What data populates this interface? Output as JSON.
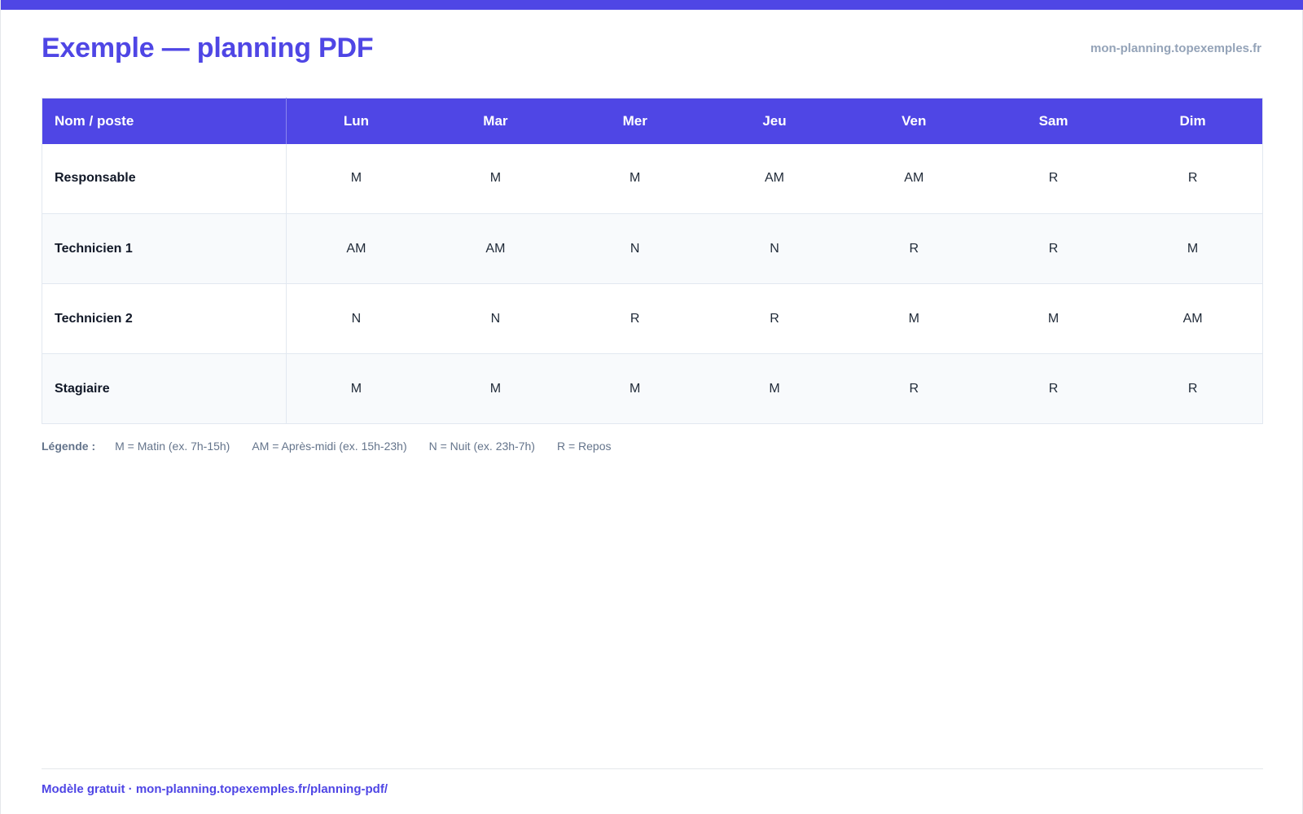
{
  "header": {
    "title": "Exemple — planning PDF",
    "site": "mon-planning.topexemples.fr"
  },
  "table": {
    "name_header": "Nom / poste",
    "days": [
      "Lun",
      "Mar",
      "Mer",
      "Jeu",
      "Ven",
      "Sam",
      "Dim"
    ],
    "rows": [
      {
        "name": "Responsable",
        "shifts": [
          "M",
          "M",
          "M",
          "AM",
          "AM",
          "R",
          "R"
        ]
      },
      {
        "name": "Technicien 1",
        "shifts": [
          "AM",
          "AM",
          "N",
          "N",
          "R",
          "R",
          "M"
        ]
      },
      {
        "name": "Technicien 2",
        "shifts": [
          "N",
          "N",
          "R",
          "R",
          "M",
          "M",
          "AM"
        ]
      },
      {
        "name": "Stagiaire",
        "shifts": [
          "M",
          "M",
          "M",
          "M",
          "R",
          "R",
          "R"
        ]
      }
    ]
  },
  "legend": {
    "label": "Légende :",
    "items": [
      "M = Matin (ex. 7h-15h)",
      "AM = Après-midi (ex. 15h-23h)",
      "N = Nuit (ex. 23h-7h)",
      "R = Repos"
    ]
  },
  "footer": {
    "text": "Modèle gratuit · mon-planning.topexemples.fr/planning-pdf/"
  },
  "colors": {
    "accent": "#4f46e5",
    "row_alt": "#f8fafc",
    "muted": "#94a3b8"
  }
}
